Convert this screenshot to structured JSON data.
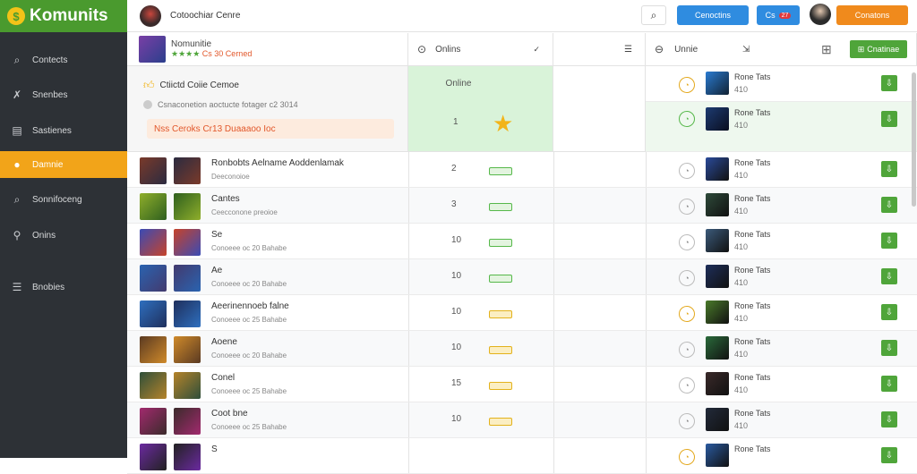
{
  "app": {
    "logo": "Komunits",
    "logo_coin": "$"
  },
  "sidebar": {
    "items": [
      {
        "label": "Contects",
        "icon": "search-icon",
        "glyph": "⌕",
        "active": false
      },
      {
        "label": "Snenbes",
        "icon": "tools-icon",
        "glyph": "✗",
        "active": false
      },
      {
        "label": "Sastienes",
        "icon": "clipboard-icon",
        "glyph": "▤",
        "active": false
      },
      {
        "label": "Damnie",
        "icon": "coin-icon",
        "glyph": "●",
        "active": true
      },
      {
        "label": "Sonnifoceng",
        "icon": "search-icon",
        "glyph": "⌕",
        "active": false
      },
      {
        "label": "Onins",
        "icon": "pin-icon",
        "glyph": "⚲",
        "active": false
      },
      {
        "label": "Bnobies",
        "icon": "list-icon",
        "glyph": "☰",
        "active": false
      }
    ]
  },
  "topbar": {
    "title": "Cotoochiar Cenre",
    "search_glyph": "⌕",
    "btn1_label": "Cenoctins",
    "btn2_label": "Cs",
    "btn2_badge": "27",
    "btn3_label": "Conatons"
  },
  "columns": {
    "col2_label": "Onlins",
    "col2_left_glyph": "⊙",
    "col2_right_glyph": "✓",
    "col2_menu_glyph": "☰",
    "col3_label": "Unnie",
    "col3_left_glyph": "⊖",
    "col3_right_glyph": "⇲",
    "col3_plus_glyph": "⊞",
    "col3_btn_label": "Cnatinae",
    "col3_btn_glyph": "⊞"
  },
  "featured": {
    "title": "Nomunitie",
    "rating_stars": "★★★★",
    "rating_text": "Cs 30 Cerned",
    "banner_title": "Ctiictd Coiie Cemoe",
    "banner_subtitle": "Csnaconetion aoctucte fotager c2 3014",
    "alert": "Nss Ceroks Cr13 Duaaaoo Ioc",
    "online_label": "Online",
    "online_value": "1"
  },
  "rows": [
    {
      "name": "Ronbobts Aelname Aoddenlamak",
      "sub": "Deeconoioe",
      "num": "2",
      "tag": "green",
      "note": "Rone Tats",
      "val": "410",
      "circ": "plain"
    },
    {
      "name": "Cantes",
      "sub": "Ceecconone preoioe",
      "num": "3",
      "tag": "green",
      "note": "Rone Tats",
      "val": "410",
      "circ": "plain"
    },
    {
      "name": "Se",
      "sub": "Conoeee oc 20 Bahabe",
      "num": "10",
      "tag": "green",
      "note": "Rone Tats",
      "val": "410",
      "circ": "plain"
    },
    {
      "name": "Ae",
      "sub": "Conoeee oc 20 Bahabe",
      "num": "10",
      "tag": "green",
      "note": "Rone Tats",
      "val": "410",
      "circ": "plain"
    },
    {
      "name": "Aeerinennoeb falne",
      "sub": "Conoeee oc 25 Bahabe",
      "num": "10",
      "tag": "yellow",
      "note": "Rone Tats",
      "val": "410",
      "circ": "gold"
    },
    {
      "name": "Aoene",
      "sub": "Conoeee oc 20 Bahabe",
      "num": "10",
      "tag": "yellow",
      "note": "Rone Tats",
      "val": "410",
      "circ": "plain"
    },
    {
      "name": "Conel",
      "sub": "Conoeee oc 25 Bahabe",
      "num": "15",
      "tag": "yellow",
      "note": "Rone Tats",
      "val": "410",
      "circ": "plain"
    },
    {
      "name": "Coot bne",
      "sub": "Conoeee oc 25 Bahabe",
      "num": "10",
      "tag": "yellow",
      "note": "Rone Tats",
      "val": "410",
      "circ": "plain"
    },
    {
      "name": "S",
      "sub": "",
      "num": "",
      "tag": "",
      "note": "Rone Tats",
      "val": "",
      "circ": "gold"
    }
  ],
  "right_top": [
    {
      "note": "Rone Tats",
      "val": "410",
      "circ": "gold"
    },
    {
      "note": "Rone Tats",
      "val": "410",
      "circ": "green"
    }
  ],
  "colors": {
    "accent": "#4a9a2e",
    "active": "#f2a419",
    "sidebar": "#2d3136",
    "online_bg": "#d9f3d9"
  }
}
